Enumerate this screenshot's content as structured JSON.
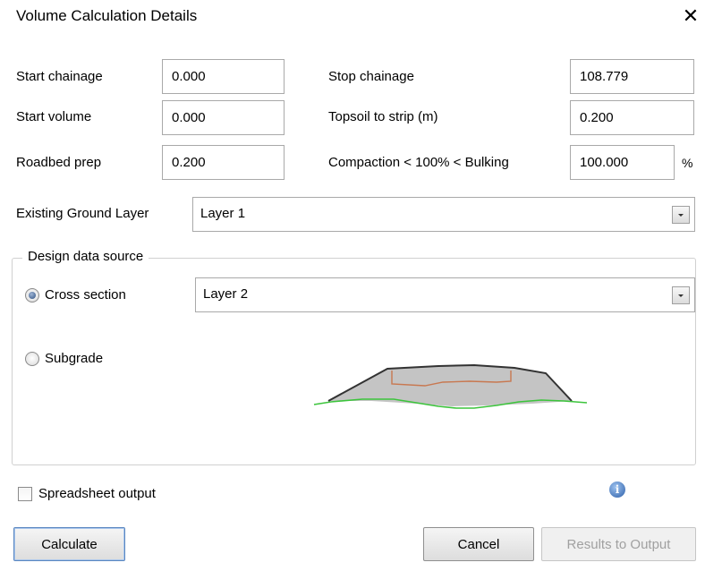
{
  "window": {
    "title": "Volume Calculation Details",
    "close_glyph": "✕"
  },
  "fields": {
    "start_chainage": {
      "label": "Start chainage",
      "value": "0.000"
    },
    "stop_chainage": {
      "label": "Stop chainage",
      "value": "108.779"
    },
    "start_volume": {
      "label": "Start volume",
      "value": "0.000"
    },
    "topsoil": {
      "label": "Topsoil to strip (m)",
      "value": "0.200"
    },
    "roadbed": {
      "label": "Roadbed prep",
      "value": "0.200"
    },
    "compaction": {
      "label": "Compaction < 100% < Bulking",
      "value": "100.000",
      "unit": "%"
    }
  },
  "existing_ground": {
    "label": "Existing Ground Layer",
    "selected": "Layer 1"
  },
  "design_source": {
    "legend": "Design data source",
    "cross_section": {
      "label": "Cross section",
      "selected": true,
      "layer": "Layer 2"
    },
    "subgrade": {
      "label": "Subgrade",
      "selected": false
    }
  },
  "spreadsheet": {
    "label": "Spreadsheet output",
    "checked": false
  },
  "info_icon_glyph": "i",
  "buttons": {
    "calculate": "Calculate",
    "cancel": "Cancel",
    "results": "Results to Output"
  },
  "colors": {
    "road_fill": "#c4c4c4",
    "road_outline": "#333333",
    "subgrade_line": "#c87850",
    "ground_line": "#3cc43c"
  }
}
